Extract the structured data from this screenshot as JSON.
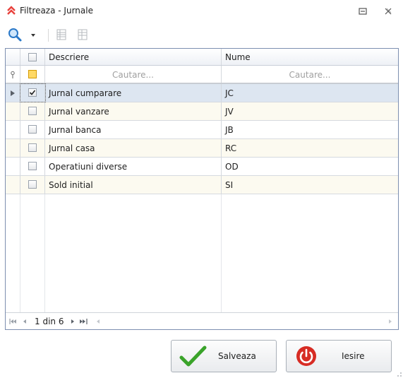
{
  "window": {
    "title": "Filtreaza - Jurnale",
    "controls": [
      "restore-icon",
      "close-icon"
    ]
  },
  "toolbar": {
    "items": [
      "search-icon",
      "dropdown-arrow-icon",
      "expand-columns-icon",
      "collapse-columns-icon"
    ]
  },
  "grid": {
    "columns": [
      "Descriere",
      "Nume"
    ],
    "filter_placeholders": [
      "Cautare...",
      "Cautare..."
    ],
    "rows": [
      {
        "descriere": "Jurnal cumparare",
        "nume": "JC",
        "checked": true,
        "current": true
      },
      {
        "descriere": "Jurnal vanzare",
        "nume": "JV",
        "checked": false,
        "current": false
      },
      {
        "descriere": "Jurnal banca",
        "nume": "JB",
        "checked": false,
        "current": false
      },
      {
        "descriere": "Jurnal casa",
        "nume": "RC",
        "checked": false,
        "current": false
      },
      {
        "descriere": "Operatiuni diverse",
        "nume": "OD",
        "checked": false,
        "current": false
      },
      {
        "descriere": "Sold initial",
        "nume": "SI",
        "checked": false,
        "current": false
      }
    ],
    "row_colors": {
      "current": "#dde6f1",
      "alt": "#fcfaf0",
      "normal": "#ffffff"
    }
  },
  "pager": {
    "text": "1 din 6"
  },
  "buttons": {
    "save": "Salveaza",
    "exit": "Iesire"
  },
  "colors": {
    "title_accent": "#e8413c",
    "check_green": "#3aa32a",
    "power_red": "#d72c24"
  }
}
